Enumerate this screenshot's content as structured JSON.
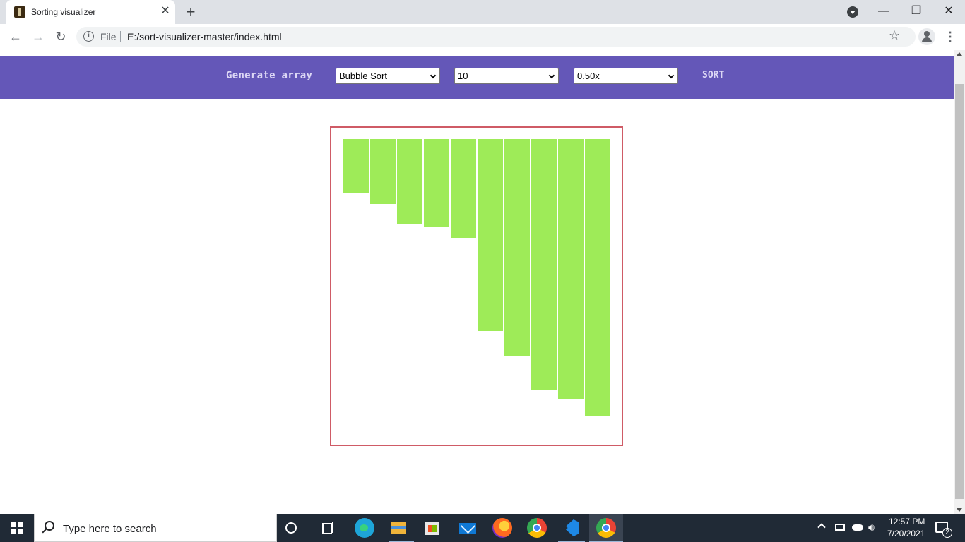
{
  "browser": {
    "tab_title": "Sorting visualizer",
    "tab_close": "✕",
    "new_tab": "+",
    "scheme_label": "File",
    "url": "E:/sort-visualizer-master/index.html",
    "window_controls": {
      "minimize": "—",
      "restore": "❐",
      "close": "✕"
    },
    "icons": [
      "back-arrow-icon",
      "forward-arrow-icon",
      "reload-icon",
      "info-icon",
      "star-icon",
      "profile-icon",
      "menu-icon"
    ]
  },
  "app": {
    "generate_label": "Generate array",
    "algorithm": {
      "selected": "Bubble Sort"
    },
    "size": {
      "selected": "10"
    },
    "speed": {
      "selected": "0.50x"
    },
    "sort_label": "SORT",
    "colors": {
      "navbar": "#6457b8",
      "bar": "#9eeb58",
      "border": "#cf5b66"
    },
    "bars": [
      19,
      23,
      30,
      31,
      35,
      68,
      77,
      89,
      92,
      98
    ]
  },
  "taskbar": {
    "search_placeholder": "Type here to search",
    "time": "12:57 PM",
    "date": "7/20/2021",
    "notifications": "2",
    "apps": [
      "cortana-icon",
      "task-view-icon",
      "edge-icon",
      "file-explorer-icon",
      "store-icon",
      "mail-icon",
      "firefox-icon",
      "chrome-icon",
      "vscode-icon",
      "chrome-icon"
    ]
  }
}
